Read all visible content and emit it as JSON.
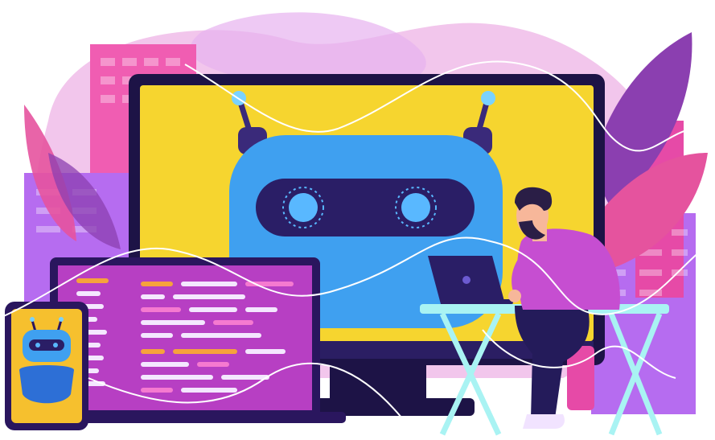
{
  "illustration": {
    "subject": "",
    "palette": {
      "background_blob": "#F2C6EC",
      "background_blob_2": "#E7B2F0",
      "building_pink": "#F05DB2",
      "building_purple": "#B66CF0",
      "building_magenta": "#E64AA7",
      "leaf_violet": "#8B3FB0",
      "leaf_pink": "#E5539E",
      "monitor_frame": "#1D1346",
      "monitor_screen": "#F6D52F",
      "robot_blue": "#3FA0F0",
      "robot_blue_dark": "#2D6FD6",
      "robot_visor": "#2A1E66",
      "robot_eye": "#59B8FF",
      "antenna_tip": "#7AD2FF",
      "laptop_screen": "#B73FC3",
      "laptop_frame": "#2A165E",
      "code_white": "#F4E7FF",
      "code_orange": "#F6A23C",
      "code_pink": "#F57AD0",
      "phone_screen": "#F6C02E",
      "person_shirt": "#C64ED1",
      "person_pants": "#241B5A",
      "person_skin": "#F7B79A",
      "hair": "#2A1E46",
      "desk_cyan": "#A9F3F3",
      "cable_white": "#FFFFFF"
    }
  }
}
